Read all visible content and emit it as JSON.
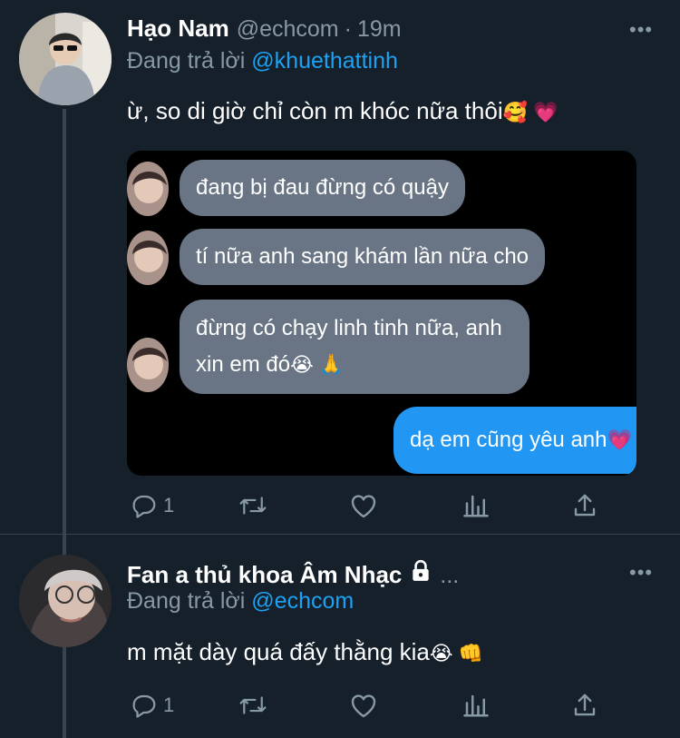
{
  "tweets": [
    {
      "name": "Hạo Nam",
      "handle": "@echcom",
      "time": "19m",
      "reply_prefix": "Đang trả lời",
      "reply_to": "@khuethattinh",
      "text": "ừ, so di giờ chỉ còn m khóc nữa thôi",
      "emojis": "🥰 💗",
      "media": {
        "messages": [
          {
            "from": "other",
            "text": "đang bị đau đừng có quậy"
          },
          {
            "from": "other",
            "text": "tí nữa anh sang khám lần nữa cho"
          },
          {
            "from": "other",
            "line1": "đừng có chạy linh tinh nữa, anh",
            "line2": "xin em đó",
            "emoji": "😭 🙏"
          },
          {
            "from": "me",
            "text": "dạ em cũng yêu anh",
            "emoji": "💗"
          }
        ]
      },
      "actions": {
        "reply_count": "1",
        "retweet_count": "",
        "like_count": ""
      }
    },
    {
      "name": "Fan a thủ khoa Âm Nhạc",
      "ellipsis": "...",
      "reply_prefix": "Đang trả lời",
      "reply_to": "@echcom",
      "text": "m mặt dày quá đấy thằng kia",
      "emojis": "😭 👊",
      "actions": {
        "reply_count": "1",
        "retweet_count": "",
        "like_count": ""
      }
    }
  ],
  "colors": {
    "background": "#15202b",
    "text_primary": "#ffffff",
    "text_secondary": "#8899a6",
    "mention": "#1da1f2",
    "bubble_other": "#697584",
    "bubble_me": "#2196f3",
    "divider": "#38444d"
  },
  "icons": [
    "reply-icon",
    "retweet-icon",
    "like-icon",
    "analytics-icon",
    "share-icon",
    "more-icon",
    "lock-icon"
  ]
}
